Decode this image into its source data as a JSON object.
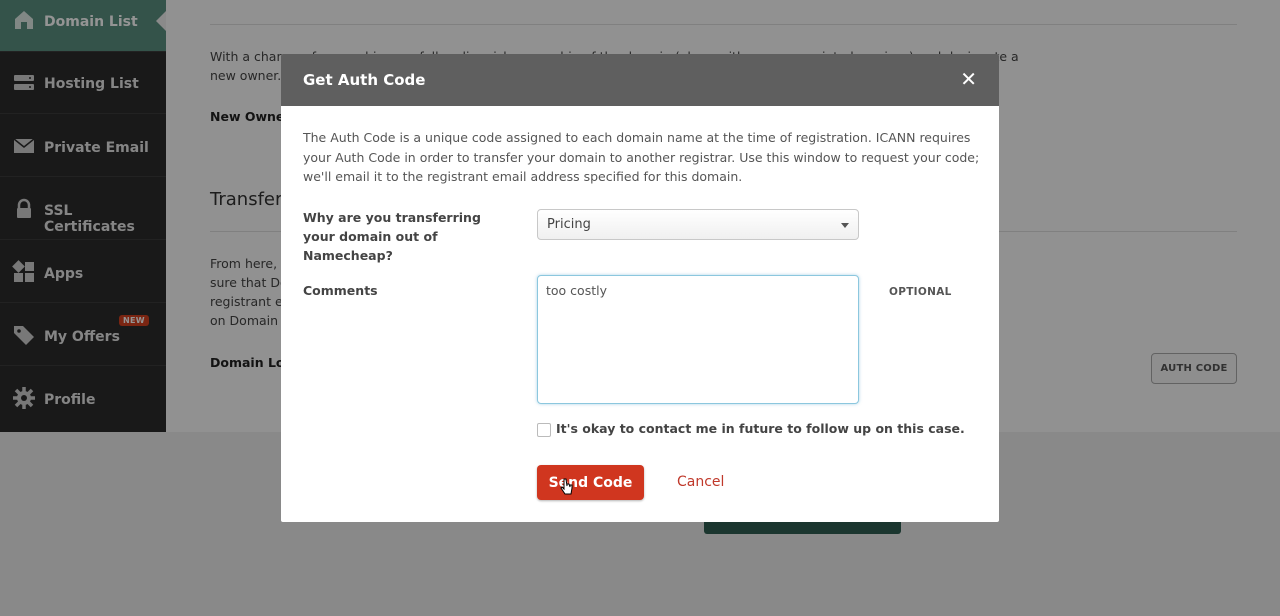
{
  "sidebar": {
    "items": [
      {
        "label": "Domain List",
        "icon": "home-icon"
      },
      {
        "label": "Hosting List",
        "icon": "server-icon"
      },
      {
        "label": "Private Email",
        "icon": "envelope-icon"
      },
      {
        "label": "SSL Certificates",
        "icon": "lock-icon"
      },
      {
        "label": "Apps",
        "icon": "apps-icon"
      },
      {
        "label": "My Offers",
        "icon": "tag-icon",
        "badge": "NEW"
      },
      {
        "label": "Profile",
        "icon": "gear-icon"
      }
    ]
  },
  "background": {
    "ownership_text_1": "With a change of ownership, you fully relinquish ownership of the domain (along with some associated services) and designate a",
    "ownership_text_2": "new owner.",
    "new_owner_label": "New Owner",
    "transfer_heading": "Transfer",
    "transfer_text_1": "From here, y",
    "transfer_text_2": "sure that Do",
    "transfer_text_3": "registrant er",
    "transfer_text_4": "on Domain I",
    "domain_lock_label": "Domain Loc",
    "auth_code_button": "AUTH CODE"
  },
  "modal": {
    "title": "Get Auth Code",
    "close_symbol": "✕",
    "description": "The Auth Code is a unique code assigned to each domain name at the time of registration. ICANN requires your Auth Code in order to transfer your domain to another registrar. Use this window to request your code; we'll email it to the registrant email address specified for this domain.",
    "reason_label": "Why are you transferring your domain out of Namecheap?",
    "reason_selected": "Pricing",
    "comments_label": "Comments",
    "comments_value": "too costly",
    "optional_label": "OPTIONAL",
    "contact_checkbox_label": "It's okay to contact me in future to follow up on this case.",
    "contact_checked": false,
    "send_button": "Send Code",
    "cancel_link": "Cancel"
  },
  "colors": {
    "sidebar_bg": "#2b2b2b",
    "sidebar_active": "#5a8f80",
    "modal_header": "#5f5f5f",
    "send_button": "#d0361f",
    "cancel_link": "#c0392b",
    "new_badge": "#d2401f"
  }
}
